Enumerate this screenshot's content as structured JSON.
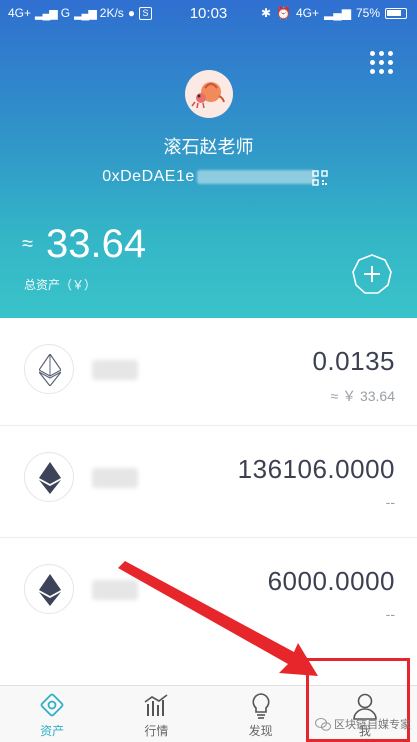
{
  "status_bar": {
    "left_text": "4G+ 4G 2K/s",
    "network_1": "4G+",
    "network_2": "G",
    "speed": "2K/s",
    "time": "10:03",
    "network_right": "4G+",
    "battery": "75%"
  },
  "wallet": {
    "name": "滚石赵老师",
    "address": "0xDeDAE1e"
  },
  "total": {
    "prefix": "≈",
    "value": "33.64",
    "label": "总资产（￥）"
  },
  "assets": [
    {
      "icon": "eth-icon",
      "amount": "0.0135",
      "fiat": "≈ ￥ 33.64"
    },
    {
      "icon": "eth-icon",
      "amount": "136106.0000",
      "fiat": "--"
    },
    {
      "icon": "eth-icon",
      "amount": "6000.0000",
      "fiat": "--"
    }
  ],
  "nav": {
    "items": [
      {
        "label": "资产",
        "icon": "wallet-icon",
        "active": true
      },
      {
        "label": "行情",
        "icon": "chart-icon",
        "active": false
      },
      {
        "label": "发现",
        "icon": "lightbulb-icon",
        "active": false
      },
      {
        "label": "我",
        "icon": "user-icon",
        "active": false
      }
    ]
  },
  "watermark": {
    "text": "区块链自媒专家"
  },
  "colors": {
    "header_top": "#2f6fd0",
    "header_bottom": "#39c3c9",
    "accent": "#2fb0c8",
    "annotation_red": "#e7262b"
  }
}
